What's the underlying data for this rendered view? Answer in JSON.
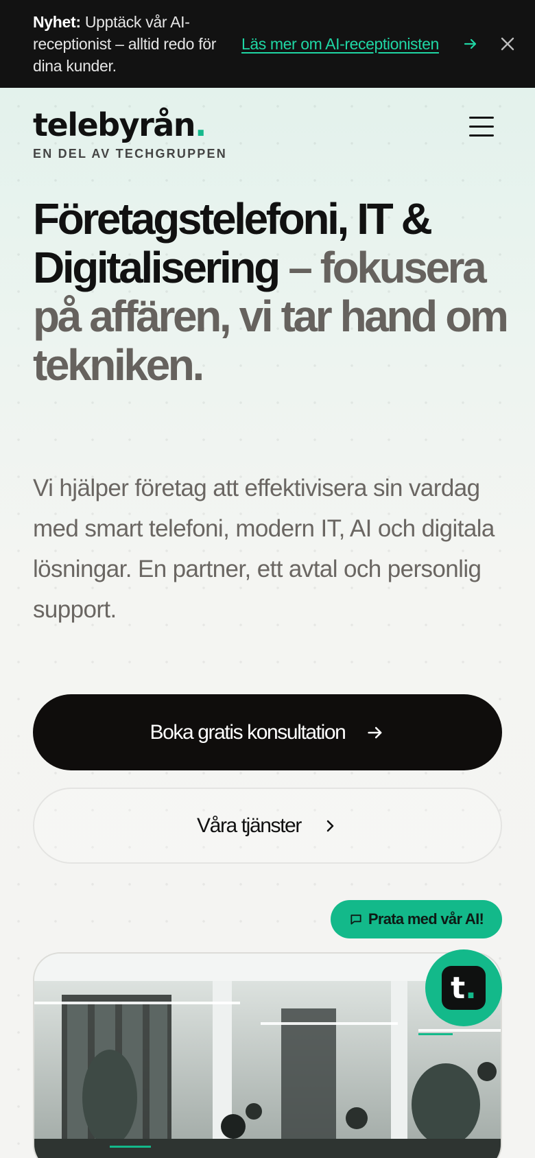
{
  "announcement": {
    "prefix": "Nyhet:",
    "text": " Upptäck vår AI-receptionist – alltid redo för dina kunder.",
    "link_label": "Läs mer om AI-receptionisten"
  },
  "header": {
    "logo_text": "telebyrån",
    "logo_dot": ".",
    "tagline": "EN DEL AV TECHGRUPPEN"
  },
  "hero": {
    "headline_dark": "Företagstelefoni, IT & Digitalisering",
    "headline_muted": " – fokusera på affären, vi tar hand om tekniken.",
    "lead": "Vi hjälper företag att effektivisera sin vardag med smart telefoni, modern IT, AI och digitala lösningar. En partner, ett avtal och personlig support.",
    "primary_cta": "Boka gratis konsultation",
    "secondary_cta": "Våra tjänster"
  },
  "chat": {
    "pill_label": "Prata med vår AI!",
    "fab_letter": "t",
    "fab_dot": "."
  },
  "colors": {
    "accent": "#13b98a",
    "link": "#1fd6a4",
    "dark": "#0f0d0c"
  },
  "icons": {
    "announce_arrow": "arrow-right-icon",
    "announce_close": "close-icon",
    "menu": "hamburger-menu-icon",
    "primary_arrow": "arrow-right-icon",
    "secondary_chevron": "chevron-right-icon",
    "chat": "chat-bubble-icon"
  }
}
